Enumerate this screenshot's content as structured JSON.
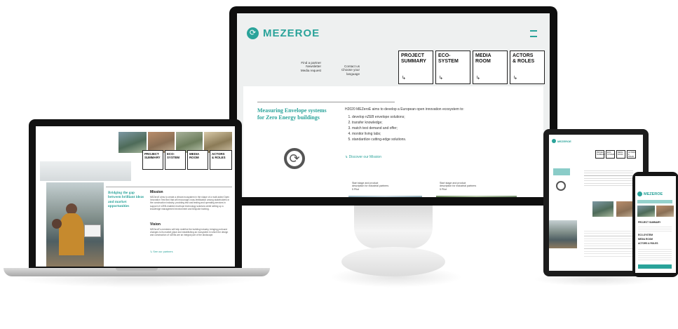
{
  "brand": {
    "name": "MEZEROE",
    "accent_color": "#2aa39a",
    "logo_icon": "recycle-arrows-icon"
  },
  "desktop": {
    "top_links_left": [
      "Find a partner",
      "Newsletter",
      "Media request"
    ],
    "top_links_right": [
      "Contact us",
      "Choose your language"
    ],
    "nav": [
      {
        "line1": "PROJECT",
        "line2": "SUMMARY"
      },
      {
        "line1": "ECO-",
        "line2": "SYSTEM"
      },
      {
        "line1": "MEDIA",
        "line2": "ROOM"
      },
      {
        "line1": "ACTORS",
        "line2": "& ROLES"
      }
    ],
    "heading_line1": "Measuring Envelope systems",
    "heading_line2": "for Zero Energy buildings",
    "intro": "H2020 MEZeroE aims to develop a European open innovation ecosystem to:",
    "goals": [
      "develop nZEB envelope solutions;",
      "transfer knowledge;",
      "match test demand and offer;",
      "monitor living labs;",
      "standardize cutting-edge solutions."
    ],
    "mission_link": "Discover our Mission",
    "columns": [
      {
        "title": "Start stage and product",
        "sub": "description for industrial partners",
        "extra": "5 Pilot"
      },
      {
        "title": "Start stage and product",
        "sub": "description for industrial partners",
        "extra": "5 Pilot"
      }
    ]
  },
  "laptop": {
    "nav": [
      {
        "line1": "PROJECT",
        "line2": "SUMMARY"
      },
      {
        "line1": "ECO-",
        "line2": "SYSTEM"
      },
      {
        "line1": "MEDIA",
        "line2": "ROOM"
      },
      {
        "line1": "ACTORS",
        "line2": "& ROLES"
      }
    ],
    "heading_line1": "Bridging the gap",
    "heading_line2": "between brilliant ideas",
    "heading_line3": "and market",
    "heading_line4": "opportunities",
    "mission_title": "Mission",
    "mission_text": "MEZeroE aims to create a vibrant ecosystem in the shape of a multi-sided Open Innovation Test Bed that will encourage cross-fertilization among stakeholders in the construction industry, providing test and testing and operating services in support of nZEB-enabled envelope technology solutions while setting up a knowledge management environment and bespoke training.",
    "vision_title": "Vision",
    "vision_text": "MEZeroE's members will help redefine the building industry, bringing profound changes to its market place and establishing an ecosystem in which the design and construction of nZEBs are an integral part of the landscape.",
    "link": "See our partners"
  },
  "tablet": {
    "logo": "MEZEROE",
    "nav": [
      "PROJECT SUMMARY",
      "ECO-SYSTEM",
      "MEDIA ROOM",
      "ACTORS & ROLES"
    ]
  },
  "phone": {
    "logo": "MEZEROE",
    "menu": [
      "PROJECT SUMMARY",
      "ECO-SYSTEM",
      "MEDIA ROOM",
      "ACTORS & ROLES"
    ]
  }
}
